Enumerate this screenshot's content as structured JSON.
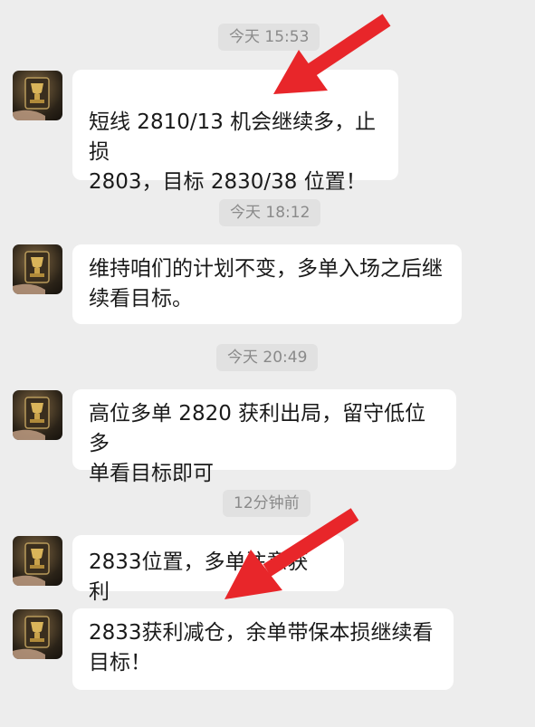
{
  "top_edge_label": "",
  "messages": [
    {
      "time": "今天 15:53",
      "text": "短线 2810/13 机会继续多，止损\n2803，目标 2830/38 位置！"
    },
    {
      "time": "今天 18:12",
      "text": "维持咱们的计划不变，多单入场之后继\n续看目标。"
    },
    {
      "time": "今天 20:49",
      "text": "高位多单 2820 获利出局，留守低位多\n单看目标即可"
    },
    {
      "time": "12分钟前",
      "text": "2833位置，多单注意获利"
    },
    {
      "time": "",
      "text": "2833获利减仓，余单带保本损继续看\n目标！"
    }
  ],
  "colors": {
    "background": "#ededed",
    "bubble": "#ffffff",
    "timestamp_bg": "#e1e1e1",
    "arrow": "#e8262a"
  },
  "icons": {
    "avatar": "trophy-avatar-icon",
    "annotation": "red-arrow-icon"
  }
}
